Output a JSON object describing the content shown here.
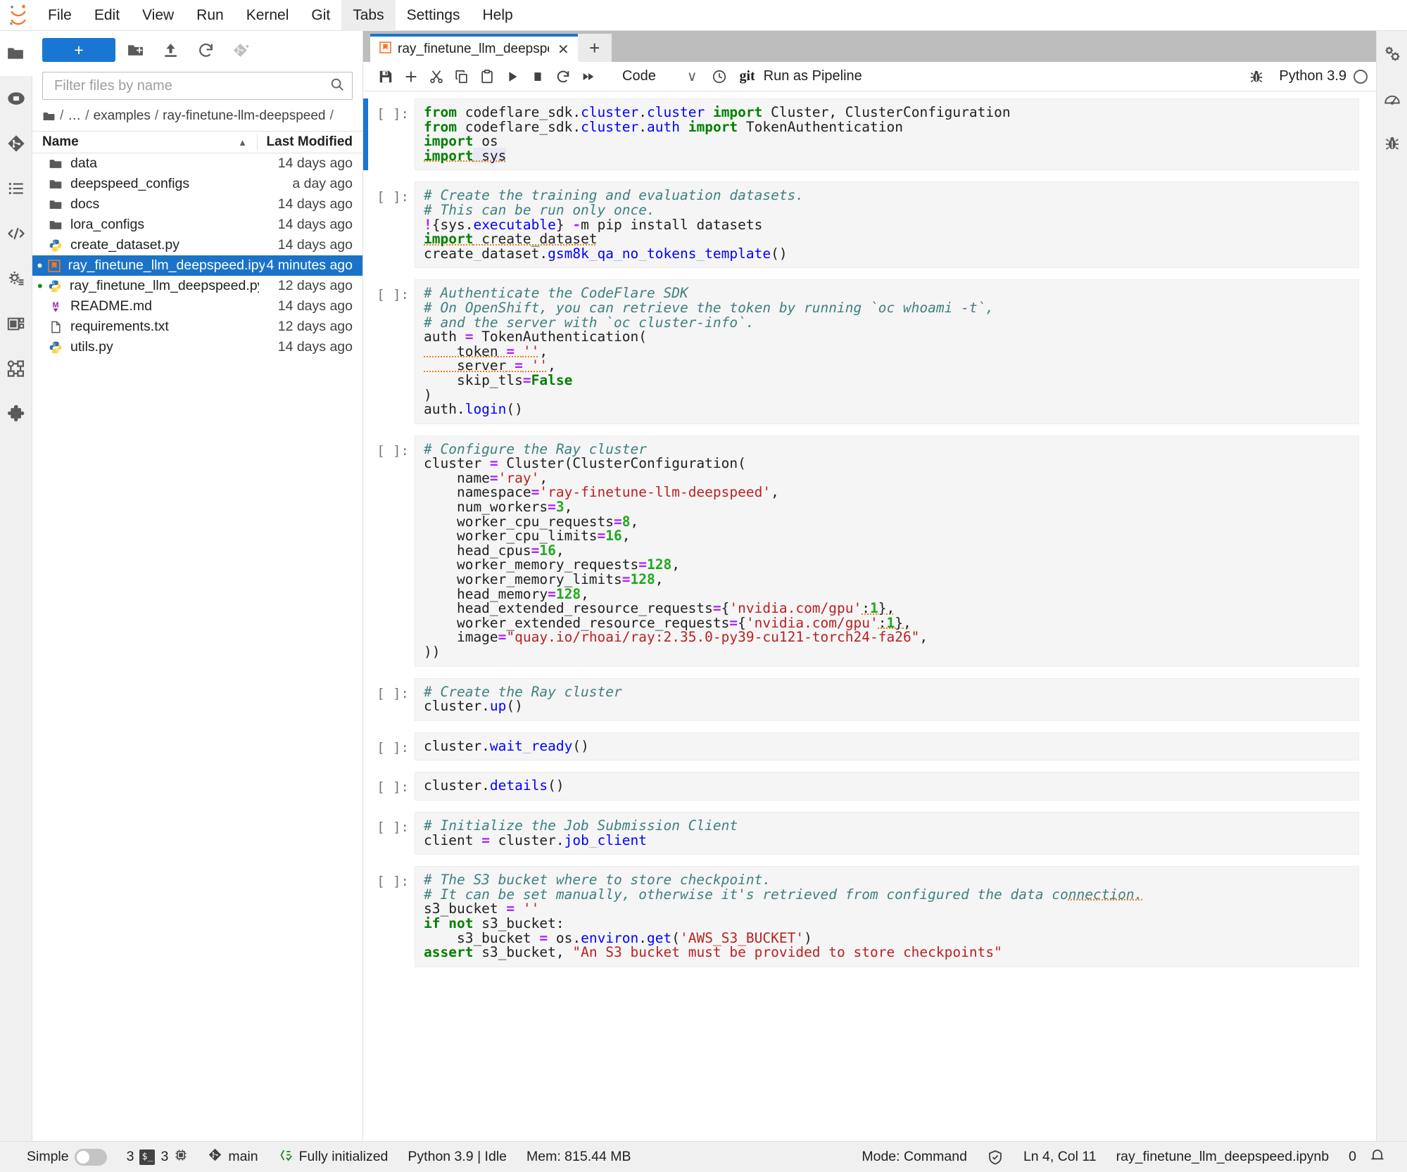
{
  "menu": {
    "items": [
      "File",
      "Edit",
      "View",
      "Run",
      "Kernel",
      "Git",
      "Tabs",
      "Settings",
      "Help"
    ],
    "active": "Tabs"
  },
  "left_activity_bar": {
    "items": [
      {
        "name": "file-browser-icon",
        "label": "File Browser"
      },
      {
        "name": "running-terminals-icon",
        "label": "Running Terminals and Kernels"
      },
      {
        "name": "git-icon",
        "label": "Git"
      },
      {
        "name": "table-of-contents-icon",
        "label": "Table of Contents"
      },
      {
        "name": "code-snippets-icon",
        "label": "Code Snippets"
      },
      {
        "name": "pipeline-settings-icon",
        "label": "Pipeline Settings"
      },
      {
        "name": "pipeline-components-icon",
        "label": "Pipeline Components"
      },
      {
        "name": "pipeline-runtimes-icon",
        "label": "Runtimes"
      },
      {
        "name": "extension-manager-icon",
        "label": "Extension Manager"
      }
    ]
  },
  "right_activity_bar": {
    "items": [
      {
        "name": "property-inspector-icon",
        "label": "Property Inspector"
      },
      {
        "name": "resource-usage-icon",
        "label": "Resource Usage"
      },
      {
        "name": "debugger-icon",
        "label": "Debugger"
      }
    ]
  },
  "file_browser": {
    "new_launcher_label": "+",
    "toolbar": [
      {
        "name": "new-folder-button",
        "label": "New Folder"
      },
      {
        "name": "upload-files-button",
        "label": "Upload Files"
      },
      {
        "name": "refresh-file-list-button",
        "label": "Refresh File List"
      },
      {
        "name": "new-git-repo-button",
        "label": "Git Clone"
      }
    ],
    "filter": {
      "placeholder": "Filter files by name",
      "value": "",
      "icon": "search-icon"
    },
    "breadcrumbs": [
      "/",
      "…",
      "examples",
      "ray-finetune-llm-deepspeed",
      "/"
    ],
    "columns": {
      "name": "Name",
      "last_modified": "Last Modified"
    },
    "sort": "ascending",
    "items": [
      {
        "name": "data",
        "icon": "folder-icon",
        "modified": "14 days ago",
        "selected": false,
        "running": false
      },
      {
        "name": "deepspeed_configs",
        "icon": "folder-icon",
        "modified": "a day ago",
        "selected": false,
        "running": false
      },
      {
        "name": "docs",
        "icon": "folder-icon",
        "modified": "14 days ago",
        "selected": false,
        "running": false
      },
      {
        "name": "lora_configs",
        "icon": "folder-icon",
        "modified": "14 days ago",
        "selected": false,
        "running": false
      },
      {
        "name": "create_dataset.py",
        "icon": "python-icon",
        "modified": "14 days ago",
        "selected": false,
        "running": false
      },
      {
        "name": "ray_finetune_llm_deepspeed.ipynb",
        "icon": "notebook-icon",
        "modified": "4 minutes ago",
        "selected": true,
        "running": true
      },
      {
        "name": "ray_finetune_llm_deepspeed.py",
        "icon": "python-icon",
        "modified": "12 days ago",
        "selected": false,
        "running": true
      },
      {
        "name": "README.md",
        "icon": "markdown-icon",
        "modified": "14 days ago",
        "selected": false,
        "running": false
      },
      {
        "name": "requirements.txt",
        "icon": "text-file-icon",
        "modified": "12 days ago",
        "selected": false,
        "running": false
      },
      {
        "name": "utils.py",
        "icon": "python-icon",
        "modified": "14 days ago",
        "selected": false,
        "running": false
      }
    ]
  },
  "notebook": {
    "tab_label": "ray_finetune_llm_deepspee",
    "tab_close": "✕",
    "tab_add": "+",
    "toolbar": {
      "buttons": [
        {
          "name": "save-button",
          "label": "Save and create checkpoint"
        },
        {
          "name": "insert-cell-button",
          "label": "Insert a cell below"
        },
        {
          "name": "cut-cells-button",
          "label": "Cut this cell"
        },
        {
          "name": "copy-cells-button",
          "label": "Copy this cell"
        },
        {
          "name": "paste-cells-button",
          "label": "Paste this cell from the clipboard"
        },
        {
          "name": "run-cell-button",
          "label": "Run the selected cells and advance"
        },
        {
          "name": "stop-kernel-button",
          "label": "Interrupt the kernel"
        },
        {
          "name": "restart-kernel-button",
          "label": "Restart the kernel"
        },
        {
          "name": "restart-run-all-button",
          "label": "Restart the kernel and run all cells"
        }
      ],
      "cell_type": "Code",
      "cell_type_caret": "∨",
      "history_icon": "clock-icon",
      "git_label": "git",
      "run_as_pipeline": "Run as Pipeline",
      "debugger_icon": "bug-icon",
      "kernel_name": "Python 3.9",
      "kernel_status": "idle"
    },
    "cells": [
      {
        "prompt": "[ ]:",
        "active": true,
        "lines": [
          [
            {
              "t": "from ",
              "c": "k"
            },
            {
              "t": "codeflare_sdk."
            },
            {
              "t": "cluster",
              "c": "mo"
            },
            {
              "t": "."
            },
            {
              "t": "cluster",
              "c": "mo"
            },
            {
              "t": " "
            },
            {
              "t": "import",
              "c": "k"
            },
            {
              "t": " Cluster, ClusterConfiguration"
            }
          ],
          [
            {
              "t": "from ",
              "c": "k"
            },
            {
              "t": "codeflare_sdk."
            },
            {
              "t": "cluster",
              "c": "mo"
            },
            {
              "t": "."
            },
            {
              "t": "auth",
              "c": "mo"
            },
            {
              "t": " "
            },
            {
              "t": "import",
              "c": "k"
            },
            {
              "t": " TokenAuthentication"
            }
          ],
          [
            {
              "t": "import",
              "c": "k"
            },
            {
              "t": " os"
            }
          ],
          [
            {
              "t": "import",
              "c": "k sq"
            },
            {
              "t": " sys",
              "c": "hl sq"
            }
          ]
        ]
      },
      {
        "prompt": "[ ]:",
        "active": false,
        "lines": [
          [
            {
              "t": "# Create the training and evaluation datasets.",
              "c": "co"
            }
          ],
          [
            {
              "t": "# This can be run only once.",
              "c": "co"
            }
          ],
          [
            {
              "t": "!",
              "c": "mg"
            },
            {
              "t": "{sys."
            },
            {
              "t": "executable",
              "c": "fn"
            },
            {
              "t": "} "
            },
            {
              "t": "-",
              "c": "op"
            },
            {
              "t": "m pip install datasets"
            }
          ],
          [
            {
              "t": "import",
              "c": "k sq"
            },
            {
              "t": " create_dataset",
              "c": "sq"
            }
          ],
          [
            {
              "t": "create_dataset."
            },
            {
              "t": "gsm8k_qa_no_tokens_template",
              "c": "fn"
            },
            {
              "t": "()"
            }
          ]
        ]
      },
      {
        "prompt": "[ ]:",
        "active": false,
        "lines": [
          [
            {
              "t": "# Authenticate the CodeFlare SDK",
              "c": "co"
            }
          ],
          [
            {
              "t": "# On OpenShift, you can retrieve the token by running `oc whoami -t`,",
              "c": "co"
            }
          ],
          [
            {
              "t": "# and the server with `oc cluster-info`.",
              "c": "co"
            }
          ],
          [
            {
              "t": "auth "
            },
            {
              "t": "=",
              "c": "op"
            },
            {
              "t": " TokenAuthentication("
            }
          ],
          [
            {
              "t": "    token",
              "c": "sq"
            },
            {
              "t": " ",
              "c": "sq"
            },
            {
              "t": "=",
              "c": "op sq"
            },
            {
              "t": " ",
              "c": "sq"
            },
            {
              "t": "''",
              "c": "st sq"
            },
            {
              "t": ","
            }
          ],
          [
            {
              "t": "    server",
              "c": "sq"
            },
            {
              "t": " ",
              "c": "sq"
            },
            {
              "t": "=",
              "c": "op sq"
            },
            {
              "t": " ",
              "c": "sq"
            },
            {
              "t": "''",
              "c": "st sq"
            },
            {
              "t": ","
            }
          ],
          [
            {
              "t": "    skip_tls"
            },
            {
              "t": "=",
              "c": "op"
            },
            {
              "t": "False",
              "c": "kb"
            }
          ],
          [
            {
              "t": ")"
            }
          ],
          [
            {
              "t": "auth."
            },
            {
              "t": "login",
              "c": "fn"
            },
            {
              "t": "()"
            }
          ]
        ]
      },
      {
        "prompt": "[ ]:",
        "active": false,
        "lines": [
          [
            {
              "t": "# Configure the Ray cluster",
              "c": "co"
            }
          ],
          [
            {
              "t": "cluster "
            },
            {
              "t": "=",
              "c": "op"
            },
            {
              "t": " Cluster(ClusterConfiguration("
            }
          ],
          [
            {
              "t": "    name"
            },
            {
              "t": "=",
              "c": "op"
            },
            {
              "t": "'ray'",
              "c": "st"
            },
            {
              "t": ","
            }
          ],
          [
            {
              "t": "    namespace"
            },
            {
              "t": "=",
              "c": "op"
            },
            {
              "t": "'ray-finetune-llm-deepspeed'",
              "c": "st"
            },
            {
              "t": ","
            }
          ],
          [
            {
              "t": "    num_workers"
            },
            {
              "t": "=",
              "c": "op"
            },
            {
              "t": "3",
              "c": "nu"
            },
            {
              "t": ","
            }
          ],
          [
            {
              "t": "    worker_cpu_requests"
            },
            {
              "t": "=",
              "c": "op"
            },
            {
              "t": "8",
              "c": "nu"
            },
            {
              "t": ","
            }
          ],
          [
            {
              "t": "    worker_cpu_limits"
            },
            {
              "t": "=",
              "c": "op"
            },
            {
              "t": "16",
              "c": "nu"
            },
            {
              "t": ","
            }
          ],
          [
            {
              "t": "    head_cpus"
            },
            {
              "t": "=",
              "c": "op"
            },
            {
              "t": "16",
              "c": "nu"
            },
            {
              "t": ","
            }
          ],
          [
            {
              "t": "    worker_memory_requests"
            },
            {
              "t": "=",
              "c": "op"
            },
            {
              "t": "128",
              "c": "nu"
            },
            {
              "t": ","
            }
          ],
          [
            {
              "t": "    worker_memory_limits"
            },
            {
              "t": "=",
              "c": "op"
            },
            {
              "t": "128",
              "c": "nu"
            },
            {
              "t": ","
            }
          ],
          [
            {
              "t": "    head_memory"
            },
            {
              "t": "=",
              "c": "op"
            },
            {
              "t": "128",
              "c": "nu"
            },
            {
              "t": ","
            }
          ],
          [
            {
              "t": "    head_extended_resource_requests"
            },
            {
              "t": "=",
              "c": "op"
            },
            {
              "t": "{"
            },
            {
              "t": "'nvidia.com/gpu'",
              "c": "st"
            },
            {
              "t": ":",
              "c": "sq"
            },
            {
              "t": "1",
              "c": "nu sq"
            },
            {
              "t": "}",
              "c": "sq"
            },
            {
              "t": ",",
              "c": "sq"
            }
          ],
          [
            {
              "t": "    worker_extended_resource_requests"
            },
            {
              "t": "=",
              "c": "op"
            },
            {
              "t": "{"
            },
            {
              "t": "'nvidia.com/gpu'",
              "c": "st"
            },
            {
              "t": ":",
              "c": "sq"
            },
            {
              "t": "1",
              "c": "nu sq"
            },
            {
              "t": "}",
              "c": "sq"
            },
            {
              "t": ",",
              "c": "sq"
            }
          ],
          [
            {
              "t": "    image"
            },
            {
              "t": "=",
              "c": "op"
            },
            {
              "t": "\"quay.io/rhoai/ray:2.35.0-py39-cu121-torch24-fa26\"",
              "c": "st"
            },
            {
              "t": ","
            }
          ],
          [
            {
              "t": "))"
            }
          ]
        ]
      },
      {
        "prompt": "[ ]:",
        "active": false,
        "lines": [
          [
            {
              "t": "# Create the Ray cluster",
              "c": "co"
            }
          ],
          [
            {
              "t": "cluster."
            },
            {
              "t": "up",
              "c": "fn"
            },
            {
              "t": "()"
            }
          ]
        ]
      },
      {
        "prompt": "[ ]:",
        "active": false,
        "lines": [
          [
            {
              "t": "cluster."
            },
            {
              "t": "wait_ready",
              "c": "fn"
            },
            {
              "t": "()"
            }
          ]
        ]
      },
      {
        "prompt": "[ ]:",
        "active": false,
        "lines": [
          [
            {
              "t": "cluster."
            },
            {
              "t": "details",
              "c": "fn"
            },
            {
              "t": "()"
            }
          ]
        ]
      },
      {
        "prompt": "[ ]:",
        "active": false,
        "lines": [
          [
            {
              "t": "# Initialize the Job Submission Client",
              "c": "co"
            }
          ],
          [
            {
              "t": "client "
            },
            {
              "t": "=",
              "c": "op"
            },
            {
              "t": " cluster."
            },
            {
              "t": "job_client",
              "c": "fn"
            }
          ]
        ]
      },
      {
        "prompt": "[ ]:",
        "active": false,
        "lines": [
          [
            {
              "t": "# The S3 bucket where to store checkpoint.",
              "c": "co"
            }
          ],
          [
            {
              "t": "# It can be set manually, otherwise it's retrieved from configured the data co",
              "c": "co"
            },
            {
              "t": "nnection.",
              "c": "co sq"
            }
          ],
          [
            {
              "t": "s3_bucket "
            },
            {
              "t": "=",
              "c": "op"
            },
            {
              "t": " "
            },
            {
              "t": "''",
              "c": "st"
            }
          ],
          [
            {
              "t": "if",
              "c": "k"
            },
            {
              "t": " "
            },
            {
              "t": "not",
              "c": "k"
            },
            {
              "t": " s3_bucket:"
            }
          ],
          [
            {
              "t": "    s3_bucket "
            },
            {
              "t": "=",
              "c": "op"
            },
            {
              "t": " os."
            },
            {
              "t": "environ",
              "c": "fn"
            },
            {
              "t": "."
            },
            {
              "t": "get",
              "c": "fn"
            },
            {
              "t": "("
            },
            {
              "t": "'AWS_S3_BUCKET'",
              "c": "st"
            },
            {
              "t": ")"
            }
          ],
          [
            {
              "t": "assert",
              "c": "k"
            },
            {
              "t": " s3_bucket, "
            },
            {
              "t": "\"An S3 bucket must be provided to store checkpoints\"",
              "c": "st"
            }
          ]
        ]
      }
    ]
  },
  "statusbar": {
    "simple_label": "Simple",
    "simple_on": false,
    "kernel_count": "3",
    "terminal_badge": "$_",
    "terminal_count": "3",
    "branch": "main",
    "elyra_status": "Fully initialized",
    "kernel_info": "Python 3.9 | Idle",
    "memory": "Mem: 815.44 MB",
    "mode": "Mode: Command",
    "cursor": "Ln 4, Col 11",
    "filename": "ray_finetune_llm_deepspeed.ipynb",
    "notification_count": "0"
  },
  "colors": {
    "accent_blue": "#1976d2",
    "selection_blue": "#1a73c8",
    "tab_bg": "#bdbdbd",
    "panel_bg": "#f0f0f0",
    "cell_bg": "#f5f5f5"
  }
}
